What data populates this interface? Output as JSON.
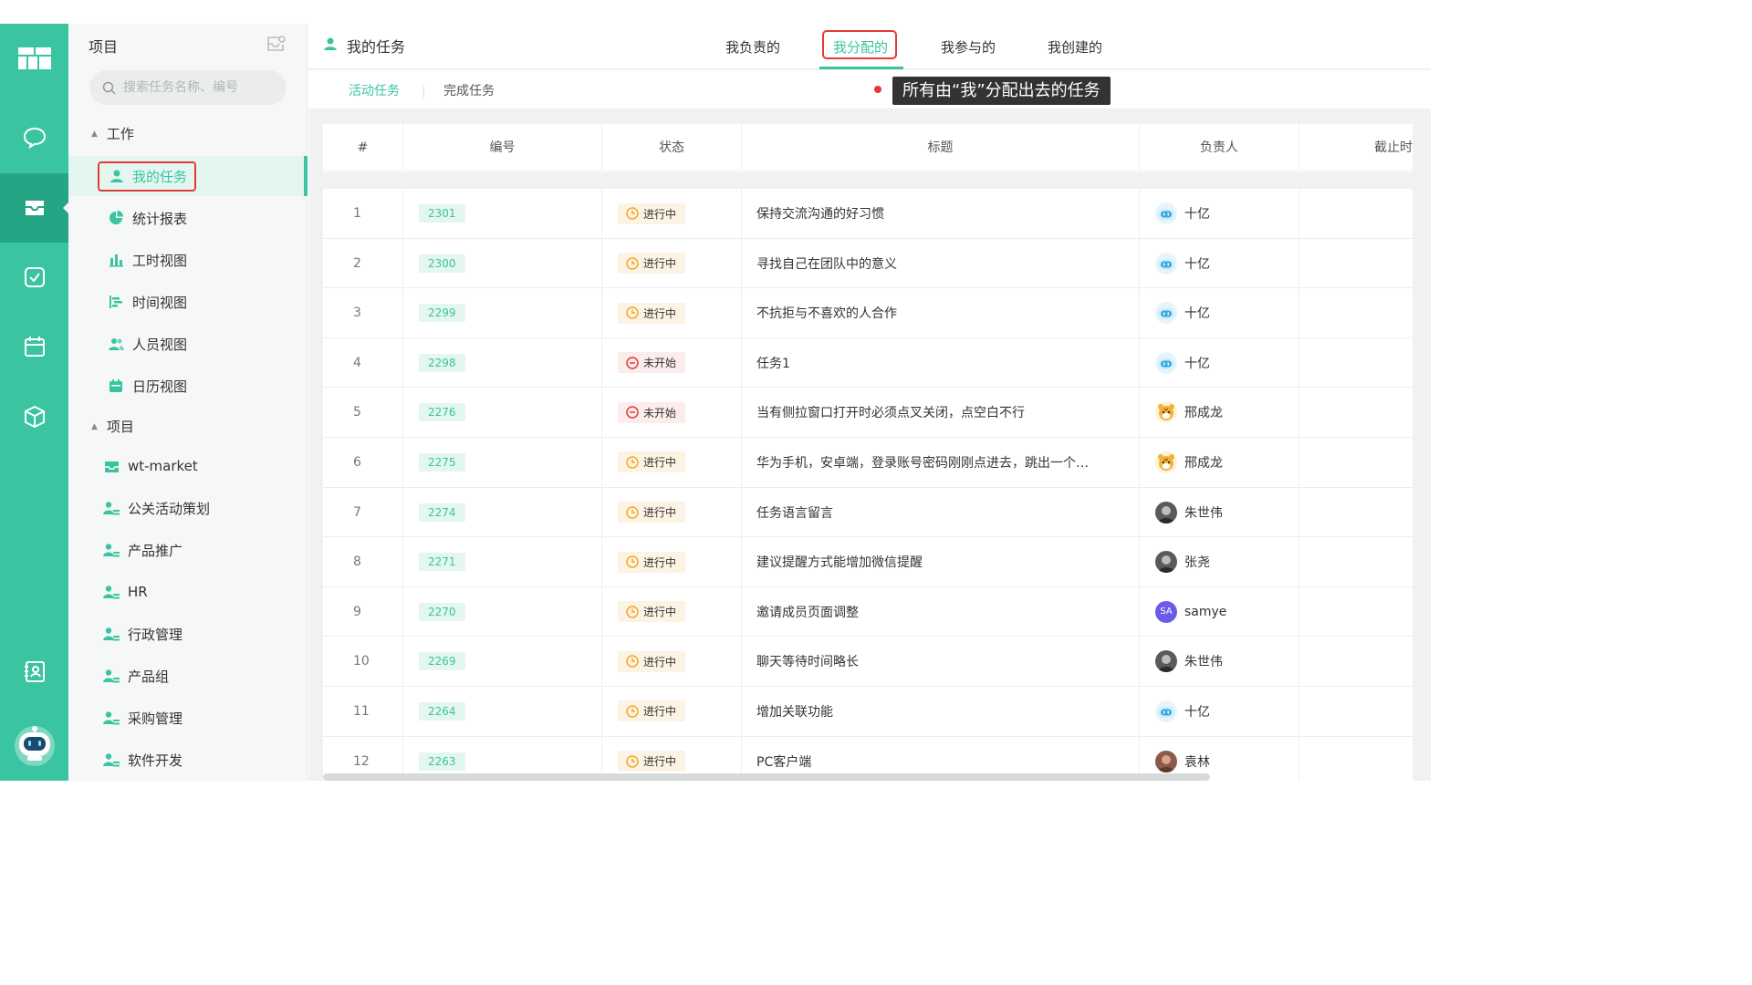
{
  "sidebar": {
    "header": "项目",
    "search_placeholder": "搜索任务名称、编号",
    "group_work": "工作",
    "group_project": "项目",
    "work_items": [
      {
        "label": "我的任务"
      },
      {
        "label": "统计报表"
      },
      {
        "label": "工时视图"
      },
      {
        "label": "时间视图"
      },
      {
        "label": "人员视图"
      },
      {
        "label": "日历视图"
      }
    ],
    "project_items": [
      {
        "label": "wt-market"
      },
      {
        "label": "公关活动策划"
      },
      {
        "label": "产品推广"
      },
      {
        "label": "HR"
      },
      {
        "label": "行政管理"
      },
      {
        "label": "产品组"
      },
      {
        "label": "采购管理"
      },
      {
        "label": "软件开发"
      }
    ]
  },
  "header": {
    "title": "我的任务",
    "tabs": [
      {
        "label": "我负责的"
      },
      {
        "label": "我分配的"
      },
      {
        "label": "我参与的"
      },
      {
        "label": "我创建的"
      }
    ],
    "active_tab": "我分配的"
  },
  "subtabs": [
    {
      "label": "活动任务"
    },
    {
      "label": "完成任务"
    }
  ],
  "tooltip": "所有由“我”分配出去的任务",
  "table": {
    "columns": [
      "#",
      "编号",
      "状态",
      "标题",
      "负责人",
      "截止时"
    ],
    "rows": [
      {
        "idx": "1",
        "code": "2301",
        "status": "进行中",
        "title": "保持交流沟通的好习惯",
        "owner": "十亿",
        "avatar": "robot"
      },
      {
        "idx": "2",
        "code": "2300",
        "status": "进行中",
        "title": "寻找自己在团队中的意义",
        "owner": "十亿",
        "avatar": "robot"
      },
      {
        "idx": "3",
        "code": "2299",
        "status": "进行中",
        "title": "不抗拒与不喜欢的人合作",
        "owner": "十亿",
        "avatar": "robot"
      },
      {
        "idx": "4",
        "code": "2298",
        "status": "未开始",
        "title": "任务1",
        "owner": "十亿",
        "avatar": "robot"
      },
      {
        "idx": "5",
        "code": "2276",
        "status": "未开始",
        "title": "当有侧拉窗口打开时必须点叉关闭，点空白不行",
        "owner": "邢成龙",
        "avatar": "tiger"
      },
      {
        "idx": "6",
        "code": "2275",
        "status": "进行中",
        "title": "华为手机，安卓端，登录账号密码刚刚点进去，跳出一个…",
        "owner": "邢成龙",
        "avatar": "tiger"
      },
      {
        "idx": "7",
        "code": "2274",
        "status": "进行中",
        "title": "任务语言留言",
        "owner": "朱世伟",
        "avatar": "photo"
      },
      {
        "idx": "8",
        "code": "2271",
        "status": "进行中",
        "title": "建议提醒方式能增加微信提醒",
        "owner": "张尧",
        "avatar": "photo"
      },
      {
        "idx": "9",
        "code": "2270",
        "status": "进行中",
        "title": "邀请成员页面调整",
        "owner": "samye",
        "avatar": "sa",
        "avatar_text": "SA"
      },
      {
        "idx": "10",
        "code": "2269",
        "status": "进行中",
        "title": "聊天等待时间略长",
        "owner": "朱世伟",
        "avatar": "photo"
      },
      {
        "idx": "11",
        "code": "2264",
        "status": "进行中",
        "title": "增加关联功能",
        "owner": "十亿",
        "avatar": "robot"
      },
      {
        "idx": "12",
        "code": "2263",
        "status": "进行中",
        "title": "PC客户端",
        "owner": "袁林",
        "avatar": "photo2"
      }
    ]
  },
  "colors": {
    "brand": "#3ac4a1",
    "rail_active": "#25a585",
    "highlight_box": "#e53935",
    "status_doing": "#f5a623",
    "status_todo": "#e53935"
  }
}
